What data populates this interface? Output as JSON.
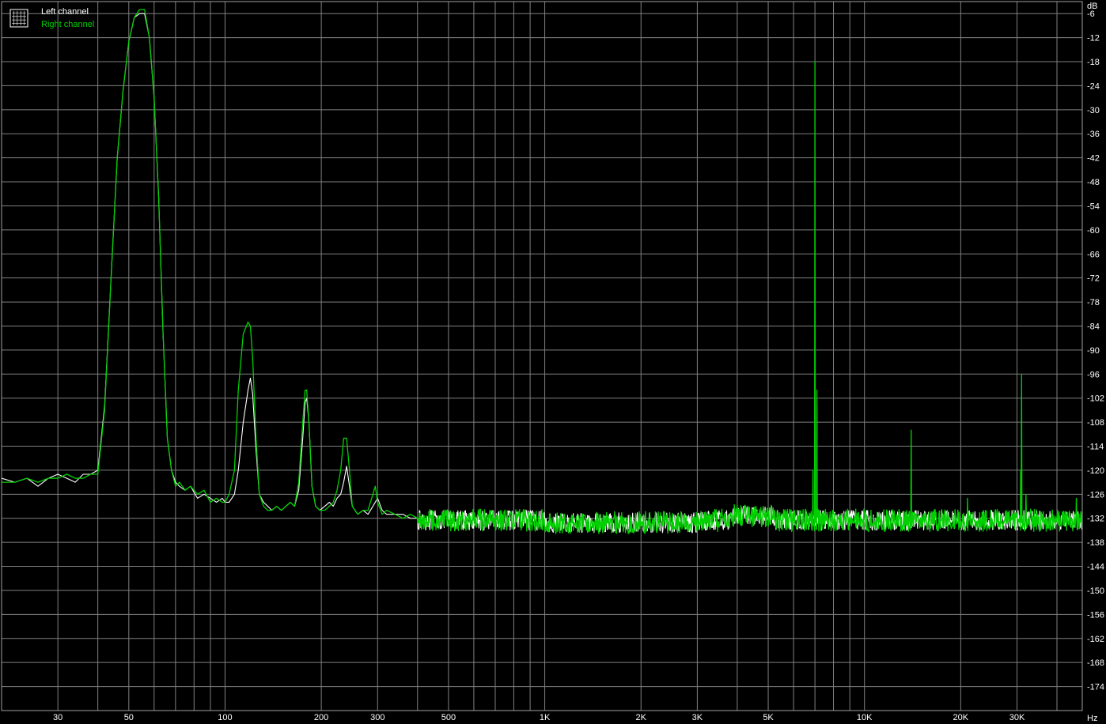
{
  "chart_data": {
    "type": "line",
    "x_scale": "log",
    "y_unit": "dB",
    "x_unit": "Hz",
    "xlim": [
      20,
      48000
    ],
    "ylim": [
      -180,
      -3
    ],
    "grid": true,
    "legend_position": "top-left",
    "colors": {
      "background": "#000000",
      "grid": "#808080",
      "left": "#ffffff",
      "right": "#00d000"
    },
    "y_ticks": [
      -6,
      -12,
      -18,
      -24,
      -30,
      -36,
      -42,
      -48,
      -54,
      -60,
      -66,
      -72,
      -78,
      -84,
      -90,
      -96,
      -102,
      -108,
      -114,
      -120,
      -126,
      -132,
      -138,
      -144,
      -150,
      -156,
      -162,
      -168,
      -174
    ],
    "x_ticks": [
      {
        "v": 30,
        "label": "30"
      },
      {
        "v": 50,
        "label": "50"
      },
      {
        "v": 100,
        "label": "100"
      },
      {
        "v": 200,
        "label": "200"
      },
      {
        "v": 300,
        "label": "300"
      },
      {
        "v": 500,
        "label": "500"
      },
      {
        "v": 1000,
        "label": "1K"
      },
      {
        "v": 2000,
        "label": "2K"
      },
      {
        "v": 3000,
        "label": "3K"
      },
      {
        "v": 5000,
        "label": "5K"
      },
      {
        "v": 10000,
        "label": "10K"
      },
      {
        "v": 20000,
        "label": "20K"
      },
      {
        "v": 30000,
        "label": "30K"
      }
    ],
    "series": [
      {
        "name": "Left channel",
        "color": "#ffffff",
        "points": [
          [
            20,
            -122
          ],
          [
            22,
            -123
          ],
          [
            24,
            -122
          ],
          [
            26,
            -124
          ],
          [
            28,
            -122
          ],
          [
            30,
            -121
          ],
          [
            32,
            -122
          ],
          [
            34,
            -123
          ],
          [
            36,
            -121
          ],
          [
            38,
            -121
          ],
          [
            40,
            -120
          ],
          [
            42,
            -104
          ],
          [
            44,
            -72
          ],
          [
            46,
            -42
          ],
          [
            48,
            -25
          ],
          [
            50,
            -13
          ],
          [
            52,
            -7
          ],
          [
            54,
            -6
          ],
          [
            56,
            -6
          ],
          [
            58,
            -12
          ],
          [
            60,
            -27
          ],
          [
            62,
            -52
          ],
          [
            64,
            -86
          ],
          [
            66,
            -112
          ],
          [
            68,
            -120
          ],
          [
            70,
            -123
          ],
          [
            72,
            -124
          ],
          [
            75,
            -125
          ],
          [
            78,
            -124
          ],
          [
            82,
            -127
          ],
          [
            86,
            -126
          ],
          [
            90,
            -127
          ],
          [
            94,
            -128
          ],
          [
            98,
            -127
          ],
          [
            100,
            -128
          ],
          [
            103,
            -128
          ],
          [
            107,
            -126
          ],
          [
            110,
            -120
          ],
          [
            114,
            -108
          ],
          [
            118,
            -100
          ],
          [
            120,
            -97
          ],
          [
            122,
            -101
          ],
          [
            125,
            -115
          ],
          [
            128,
            -126
          ],
          [
            132,
            -128
          ],
          [
            136,
            -129
          ],
          [
            140,
            -130
          ],
          [
            145,
            -129
          ],
          [
            150,
            -130
          ],
          [
            155,
            -129
          ],
          [
            160,
            -128
          ],
          [
            165,
            -129
          ],
          [
            170,
            -125
          ],
          [
            175,
            -112
          ],
          [
            178,
            -103
          ],
          [
            180,
            -102
          ],
          [
            183,
            -108
          ],
          [
            187,
            -124
          ],
          [
            192,
            -129
          ],
          [
            198,
            -130
          ],
          [
            205,
            -129
          ],
          [
            212,
            -128
          ],
          [
            218,
            -129
          ],
          [
            224,
            -127
          ],
          [
            230,
            -126
          ],
          [
            235,
            -123
          ],
          [
            240,
            -119
          ],
          [
            245,
            -124
          ],
          [
            250,
            -129
          ],
          [
            260,
            -131
          ],
          [
            270,
            -130
          ],
          [
            280,
            -131
          ],
          [
            290,
            -129
          ],
          [
            300,
            -127
          ],
          [
            310,
            -130
          ],
          [
            320,
            -131
          ],
          [
            340,
            -131
          ],
          [
            360,
            -131
          ],
          [
            380,
            -132
          ],
          [
            400,
            -132
          ]
        ],
        "noise": {
          "from": 400,
          "to": 48000,
          "baseline": -132.5,
          "amplitude": 2.5
        },
        "spikes": [
          {
            "f": 7000,
            "level": -92
          },
          {
            "f": 7100,
            "level": -104
          },
          {
            "f": 6900,
            "level": -128
          },
          {
            "f": 14000,
            "level": -131
          },
          {
            "f": 31000,
            "level": -128
          }
        ]
      },
      {
        "name": "Right channel",
        "color": "#00d000",
        "points": [
          [
            20,
            -123
          ],
          [
            22,
            -123
          ],
          [
            24,
            -122
          ],
          [
            26,
            -123
          ],
          [
            28,
            -122
          ],
          [
            30,
            -122
          ],
          [
            32,
            -121
          ],
          [
            34,
            -122
          ],
          [
            36,
            -122
          ],
          [
            38,
            -121
          ],
          [
            40,
            -121
          ],
          [
            42,
            -105
          ],
          [
            44,
            -72
          ],
          [
            46,
            -42
          ],
          [
            48,
            -25
          ],
          [
            50,
            -13
          ],
          [
            52,
            -7
          ],
          [
            54,
            -5
          ],
          [
            56,
            -5
          ],
          [
            58,
            -12
          ],
          [
            60,
            -27
          ],
          [
            62,
            -52
          ],
          [
            64,
            -86
          ],
          [
            66,
            -112
          ],
          [
            68,
            -120
          ],
          [
            70,
            -124
          ],
          [
            72,
            -123
          ],
          [
            75,
            -125
          ],
          [
            78,
            -124
          ],
          [
            82,
            -126
          ],
          [
            86,
            -125
          ],
          [
            90,
            -128
          ],
          [
            94,
            -127
          ],
          [
            98,
            -128
          ],
          [
            100,
            -128
          ],
          [
            103,
            -126
          ],
          [
            107,
            -120
          ],
          [
            110,
            -100
          ],
          [
            114,
            -86
          ],
          [
            118,
            -83
          ],
          [
            120,
            -84
          ],
          [
            122,
            -92
          ],
          [
            125,
            -112
          ],
          [
            128,
            -126
          ],
          [
            132,
            -129
          ],
          [
            136,
            -130
          ],
          [
            140,
            -130
          ],
          [
            145,
            -129
          ],
          [
            150,
            -130
          ],
          [
            155,
            -129
          ],
          [
            160,
            -128
          ],
          [
            165,
            -129
          ],
          [
            170,
            -123
          ],
          [
            175,
            -108
          ],
          [
            178,
            -100
          ],
          [
            180,
            -100
          ],
          [
            183,
            -108
          ],
          [
            187,
            -124
          ],
          [
            192,
            -129
          ],
          [
            198,
            -130
          ],
          [
            205,
            -130
          ],
          [
            212,
            -129
          ],
          [
            218,
            -128
          ],
          [
            224,
            -125
          ],
          [
            230,
            -120
          ],
          [
            235,
            -112
          ],
          [
            240,
            -112
          ],
          [
            245,
            -120
          ],
          [
            250,
            -129
          ],
          [
            260,
            -131
          ],
          [
            270,
            -130
          ],
          [
            280,
            -130
          ],
          [
            290,
            -126
          ],
          [
            295,
            -124
          ],
          [
            300,
            -128
          ],
          [
            310,
            -131
          ],
          [
            320,
            -130
          ],
          [
            340,
            -131
          ],
          [
            360,
            -132
          ],
          [
            380,
            -131
          ],
          [
            400,
            -132
          ]
        ],
        "noise": {
          "from": 400,
          "to": 48000,
          "baseline": -132.5,
          "amplitude": 2.8
        },
        "spikes": [
          {
            "f": 7000,
            "level": -18
          },
          {
            "f": 6900,
            "level": -120
          },
          {
            "f": 7100,
            "level": -100
          },
          {
            "f": 14000,
            "level": -110
          },
          {
            "f": 21000,
            "level": -127
          },
          {
            "f": 31000,
            "level": -96
          },
          {
            "f": 30800,
            "level": -120
          },
          {
            "f": 32000,
            "level": -126
          },
          {
            "f": 46000,
            "level": -127
          }
        ]
      }
    ]
  }
}
